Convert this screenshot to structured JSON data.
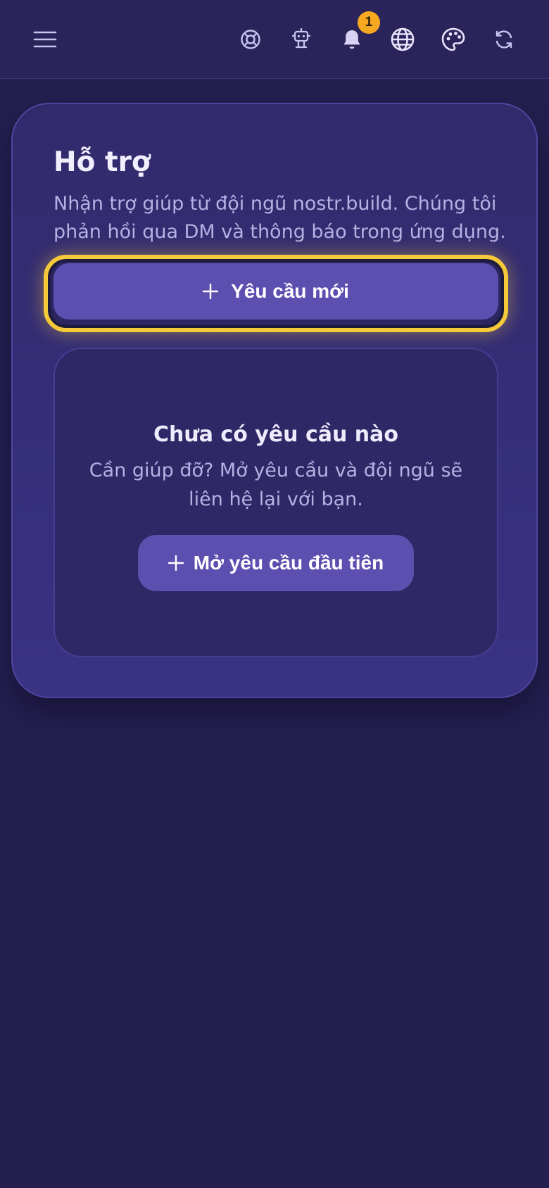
{
  "header": {
    "icons": [
      "menu-icon",
      "lifebuoy-icon",
      "robot-icon",
      "bell-icon",
      "globe-icon",
      "palette-icon",
      "refresh-icon"
    ],
    "notification_count": "1",
    "badge_color": "#f6a821"
  },
  "support": {
    "title": "Hỗ trợ",
    "description": "Nhận trợ giúp từ đội ngũ nostr.build. Chúng tôi phản hồi qua DM và thông báo trong ứng dụng.",
    "new_request_label": "Yêu cầu mới",
    "focus_ring_color": "#f4c93a",
    "button_color": "#5c4fb0"
  },
  "empty_state": {
    "title": "Chưa có yêu cầu nào",
    "description": "Cần giúp đỡ? Mở yêu cầu và đội ngũ sẽ liên hệ lại với bạn.",
    "cta_label": "Mở yêu cầu đầu tiên"
  }
}
